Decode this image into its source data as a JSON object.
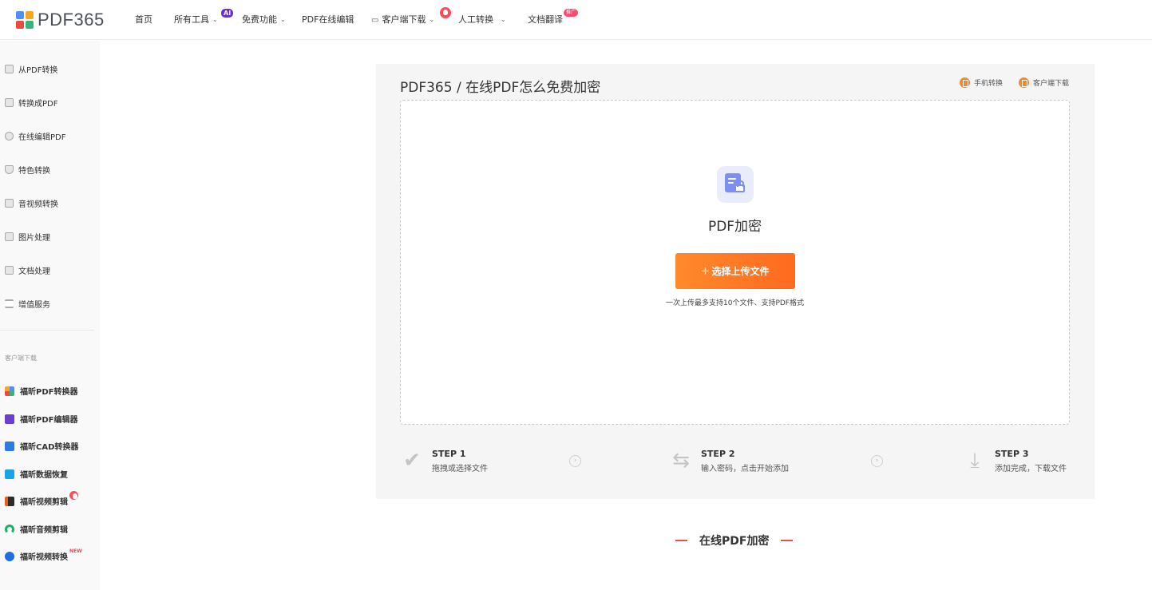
{
  "brand": {
    "logo_text": "PDF365",
    "colors": [
      "#4f8ff7",
      "#f5a623",
      "#e94b3c",
      "#36b37e"
    ]
  },
  "nav": {
    "home": "首页",
    "all_tools": "所有工具",
    "all_tools_badge": "AI",
    "free": "免费功能",
    "edit_online": "PDF在线编辑",
    "client_download": "客户端下载",
    "manual": "人工转换",
    "translate": "文档翻译",
    "translate_badge": "推广"
  },
  "sidebar": {
    "items": [
      {
        "label": "从PDF转换",
        "icon": "pdf-out-icon"
      },
      {
        "label": "转换成PDF",
        "icon": "pdf-in-icon"
      },
      {
        "label": "在线编辑PDF",
        "icon": "edit-icon"
      },
      {
        "label": "特色转换",
        "icon": "shield-icon"
      },
      {
        "label": "音视频转换",
        "icon": "media-icon"
      },
      {
        "label": "图片处理",
        "icon": "image-icon"
      },
      {
        "label": "文档处理",
        "icon": "document-icon"
      },
      {
        "label": "增值服务",
        "icon": "list-icon"
      }
    ],
    "caption": "客户端下载",
    "apps": [
      {
        "label": "福昕PDF转换器",
        "color": "#4f8ff7"
      },
      {
        "label": "福昕PDF编辑器",
        "color": "#6c3fd1"
      },
      {
        "label": "福昕CAD转换器",
        "color": "#2d7be5"
      },
      {
        "label": "福昕数据恢复",
        "color": "#1aa3e8"
      },
      {
        "label": "福昕视频剪辑",
        "color": "#e85d1a"
      },
      {
        "label": "福昕音频剪辑",
        "color": "#18b26b"
      },
      {
        "label": "福昕视频转换",
        "color": "#1e6fe0"
      }
    ],
    "app_badge_new": "NEW"
  },
  "main": {
    "breadcrumb": "PDF365 / 在线PDF怎么免费加密",
    "mobile_convert": "手机转换",
    "client_download": "客户端下载",
    "tool_title": "PDF加密",
    "upload_label": "选择上传文件",
    "upload_plus": "+",
    "upload_hint": "一次上传最多支持10个文件、支持PDF格式",
    "steps": [
      {
        "title": "STEP 1",
        "desc": "拖拽或选择文件"
      },
      {
        "title": "STEP 2",
        "desc": "输入密码，点击开始添加"
      },
      {
        "title": "STEP 3",
        "desc": "添加完成，下载文件"
      }
    ],
    "section_title": "在线PDF加密"
  },
  "accent": "#ff7a24"
}
